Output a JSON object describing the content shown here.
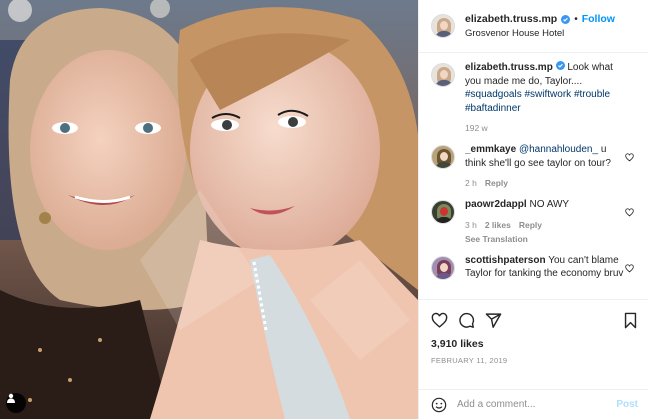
{
  "post": {
    "username": "elizabeth.truss.mp",
    "follow_label": "Follow",
    "location": "Grosvenor House Hotel",
    "separator": "•"
  },
  "comments": [
    {
      "username": "elizabeth.truss.mp",
      "text": "Look what you made me do, Taylor....",
      "hashtags": "#squadgoals #swiftwork #trouble #baftadinner",
      "time": "192 w"
    },
    {
      "username": "_emmkaye",
      "mention": "@hannahlouden_",
      "text": "u think she'll go see taylor on tour?",
      "time": "2 h",
      "reply": "Reply"
    },
    {
      "username": "paowr2dappl",
      "text": "NO AWY",
      "time": "3 h",
      "likes": "2 likes",
      "reply": "Reply",
      "see_translation": "See Translation"
    },
    {
      "username": "scottishpaterson",
      "text": "You can't blame Taylor for tanking the economy bruv",
      "time": "",
      "reply": ""
    }
  ],
  "actions": {
    "likes": "3,910 likes",
    "date": "FEBRUARY 11, 2019"
  },
  "add_comment": {
    "placeholder": "Add a comment...",
    "post_label": "Post"
  },
  "colors": {
    "accent": "#0095f6",
    "post_disabled": "#b2dffc",
    "muted": "#8e8e8e",
    "hashtag": "#00376b"
  },
  "icons": [
    "verified-badge-icon",
    "heart-icon",
    "comment-icon",
    "share-icon",
    "bookmark-icon",
    "emoji-icon",
    "user-tag-icon"
  ]
}
